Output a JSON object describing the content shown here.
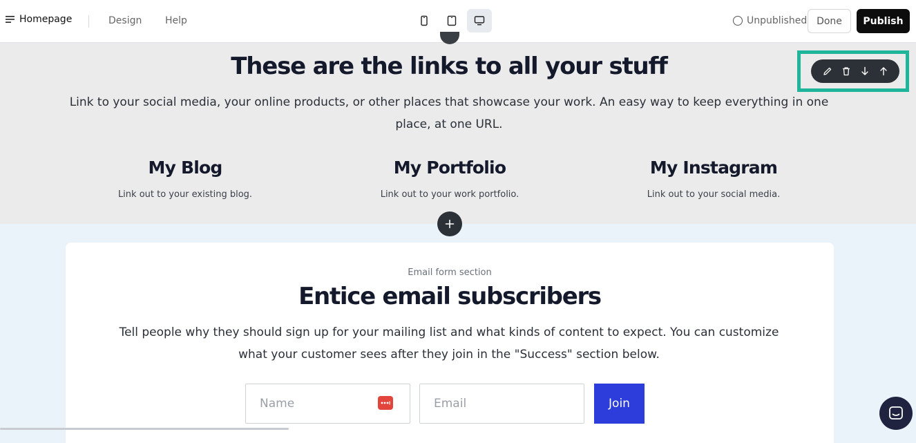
{
  "topbar": {
    "page_name": "Homepage",
    "nav": [
      "Design",
      "Help"
    ],
    "devices": [
      {
        "name": "mobile",
        "icon": "phone-icon",
        "active": false
      },
      {
        "name": "tablet",
        "icon": "tablet-icon",
        "active": false
      },
      {
        "name": "desktop",
        "icon": "monitor-icon",
        "active": true
      }
    ],
    "status": "Unpublished",
    "done_label": "Done",
    "publish_label": "Publish"
  },
  "links_section": {
    "heading": "These are the links to all your stuff",
    "lede": "Link to your social media, your online products, or other places that showcase your work. An easy way to keep everything in one place, at one URL.",
    "cards": [
      {
        "title": "My Blog",
        "subtitle": "Link out to your existing blog."
      },
      {
        "title": "My Portfolio",
        "subtitle": "Link out to your work portfolio."
      },
      {
        "title": "My Instagram",
        "subtitle": "Link out to your social media."
      }
    ],
    "toolbar": [
      "pencil-icon",
      "trash-icon",
      "arrow-down-icon",
      "arrow-up-icon"
    ],
    "highlight_color": "#1fb59b"
  },
  "email_section": {
    "caption": "Email form section",
    "heading": "Entice email subscribers",
    "description": "Tell people why they should sign up for your mailing list and what kinds of content to expect. You can customize what your customer sees after they join in the \"Success\" section below.",
    "name_placeholder": "Name",
    "email_placeholder": "Email",
    "join_label": "Join",
    "join_color": "#2d3ddb"
  }
}
